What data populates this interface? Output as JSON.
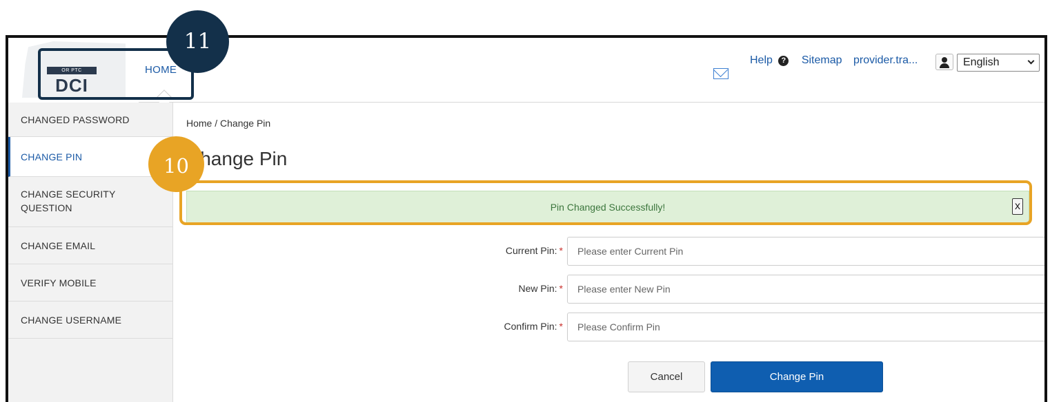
{
  "header": {
    "logo": {
      "top_text": "OR PTC",
      "main_text": "DCI"
    },
    "home_tab_label": "HOME",
    "help_label": "Help",
    "help_icon_glyph": "?",
    "sitemap_label": "Sitemap",
    "user_label": "provider.tra...",
    "language_selected": "English"
  },
  "sidebar": {
    "items": [
      {
        "label": "CHANGED PASSWORD",
        "active": false
      },
      {
        "label": "CHANGE PIN",
        "active": true
      },
      {
        "label": "CHANGE SECURITY QUESTION",
        "active": false
      },
      {
        "label": "CHANGE EMAIL",
        "active": false
      },
      {
        "label": "VERIFY MOBILE",
        "active": false
      },
      {
        "label": "CHANGE USERNAME",
        "active": false
      }
    ]
  },
  "main": {
    "breadcrumb": "Home / Change Pin",
    "title": "Change Pin",
    "alert": {
      "message": "Pin Changed Successfully!",
      "close_glyph": "x"
    },
    "form": {
      "fields": [
        {
          "label": "Current Pin:",
          "required_mark": "*",
          "placeholder": "Please enter Current Pin",
          "value": ""
        },
        {
          "label": "New Pin:",
          "required_mark": "*",
          "placeholder": "Please enter New Pin",
          "value": ""
        },
        {
          "label": "Confirm Pin:",
          "required_mark": "*",
          "placeholder": "Please Confirm Pin",
          "value": ""
        }
      ],
      "cancel_label": "Cancel",
      "submit_label": "Change Pin"
    }
  },
  "callouts": {
    "step_11": "11",
    "step_10": "10"
  },
  "colors": {
    "accent_blue": "#1b5aa6",
    "primary_button": "#0f5eb0",
    "success_bg": "#dff0d8",
    "callout_dark": "#13304a",
    "callout_orange": "#e8a425",
    "required_red": "#c9302c"
  }
}
